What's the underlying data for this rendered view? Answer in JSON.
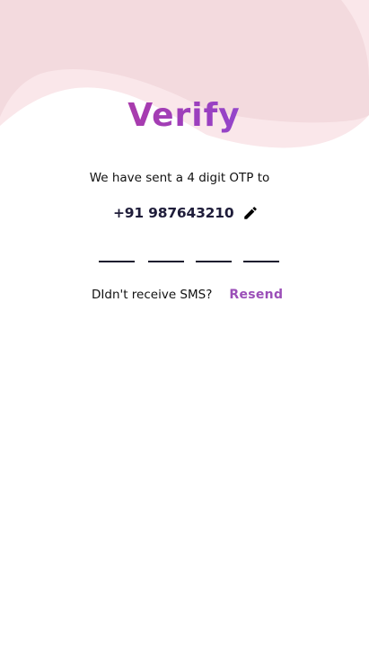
{
  "screen": {
    "title": "Verify",
    "subtitle": "We have sent a 4 digit OTP to",
    "phone_number": "+91 987643210",
    "resend_prompt": "DIdn't receive SMS?",
    "resend_label": "Resend"
  },
  "otp": {
    "digits": [
      "",
      "",
      "",
      ""
    ]
  },
  "icons": {
    "edit": "pencil-icon"
  },
  "colors": {
    "title_gradient_start": "#c0368e",
    "title_gradient_end": "#7b5cf0",
    "wave_light": "#f9e6e9",
    "wave_dark": "#f3d9de",
    "resend": "#9b4fb8",
    "phone": "#1f1d3a"
  }
}
